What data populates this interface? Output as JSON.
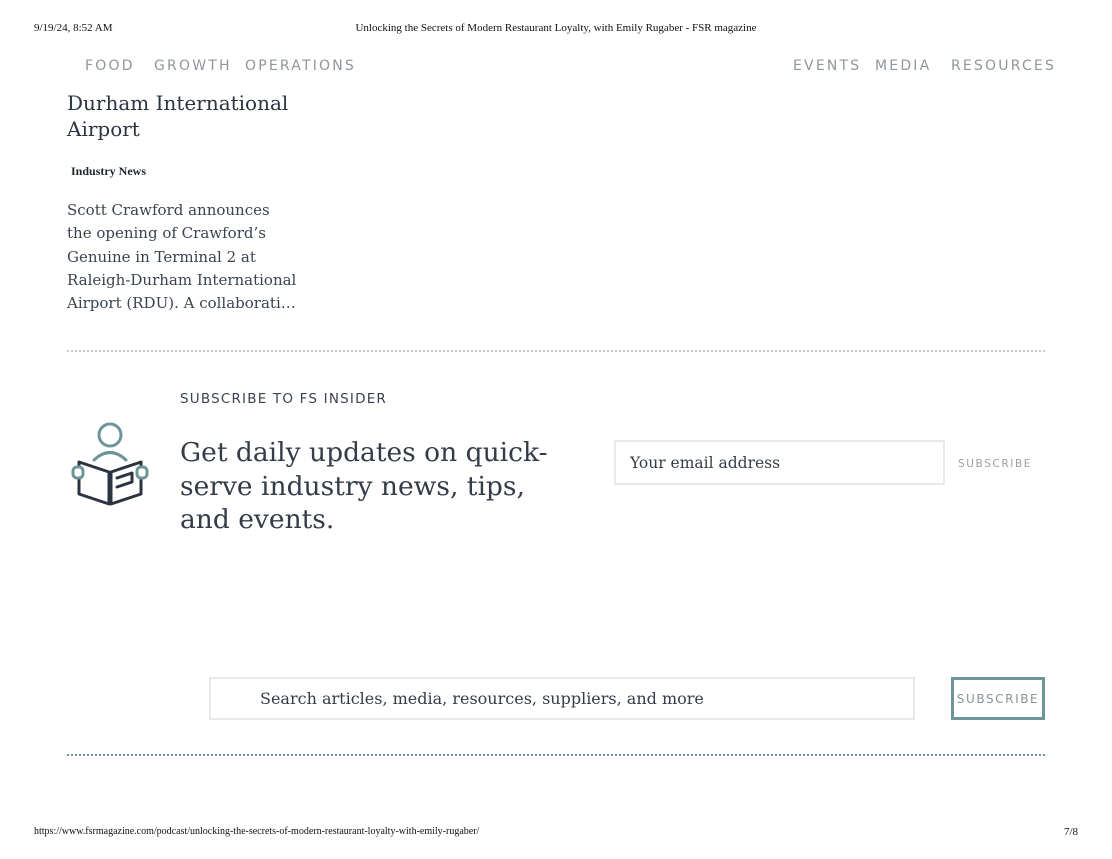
{
  "print": {
    "date": "9/19/24, 8:52 AM",
    "title": "Unlocking the Secrets of Modern Restaurant Loyalty, with Emily Rugaber - FSR magazine",
    "url": "https://www.fsrmagazine.com/podcast/unlocking-the-secrets-of-modern-restaurant-loyalty-with-emily-rugaber/",
    "page": "7/8"
  },
  "nav": {
    "left": [
      "FOOD",
      "GROWTH",
      "OPERATIONS"
    ],
    "right": [
      "EVENTS",
      "MEDIA",
      "RESOURCES"
    ]
  },
  "article": {
    "title": "Durham International Airport",
    "category": "Industry News",
    "excerpt": "Scott Crawford announces the opening of Crawford’s Genuine in Terminal 2 at Raleigh-Durham International Airport (RDU). A collaborati…"
  },
  "subscribe": {
    "heading": "SUBSCRIBE TO FS INSIDER",
    "text": "Get daily updates on quick-serve industry news, tips, and events.",
    "email_placeholder": "Your email address",
    "button": "SUBSCRIBE",
    "icon": "reader-icon"
  },
  "search": {
    "placeholder": "Search articles, media, resources, suppliers, and more",
    "button": "SUBSCRIBE"
  },
  "colors": {
    "accent": "#6e9598",
    "text": "#2b3440",
    "nav": "#8f969c"
  }
}
